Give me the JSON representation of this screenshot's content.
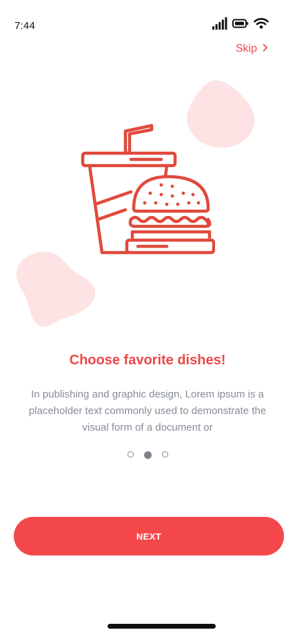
{
  "status_bar": {
    "time": "7:44",
    "icons": [
      "signal-icon",
      "battery-icon",
      "wifi-icon"
    ]
  },
  "header": {
    "skip_label": "Skip",
    "skip_icon": "chevron-right-icon"
  },
  "illustration": {
    "icon": "drink-and-burger-icon",
    "accent_color": "#e04a3c",
    "blob_color": "#fde3e3"
  },
  "content": {
    "title": "Choose favorite dishes!",
    "description": "In publishing and graphic design, Lorem ipsum is a placeholder text commonly used to demonstrate the visual form of a document or"
  },
  "pager": {
    "total_pages": 3,
    "current_page": 2
  },
  "actions": {
    "next_label": "NEXT"
  },
  "colors": {
    "primary": "#f5484a",
    "title": "#ea4848",
    "body_text": "#868b96",
    "pager_dot": "#7d828c"
  }
}
